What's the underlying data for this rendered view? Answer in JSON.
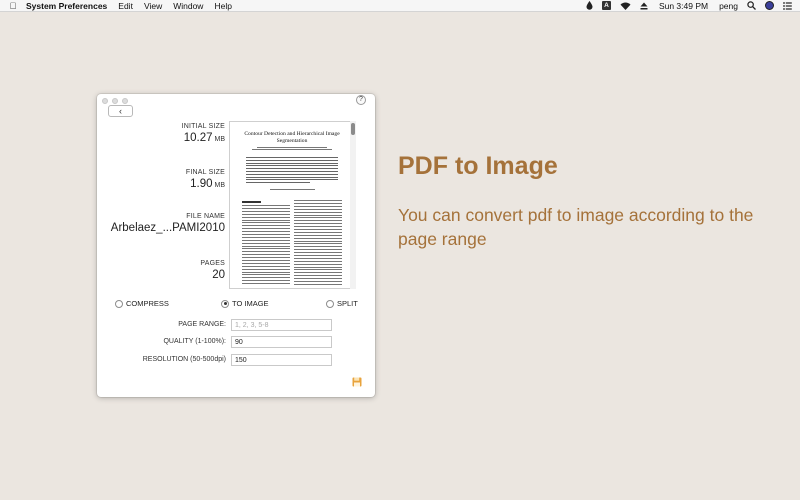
{
  "menubar": {
    "app_name": "System Preferences",
    "menus": [
      "Edit",
      "View",
      "Window",
      "Help"
    ],
    "clock": "Sun 3:49 PM",
    "user": "peng",
    "input_source": "A"
  },
  "panel": {
    "initial_size": {
      "label": "INITIAL SIZE",
      "value": "10.27",
      "unit": "MB"
    },
    "final_size": {
      "label": "FINAL SIZE",
      "value": "1.90",
      "unit": "MB"
    },
    "file_name": {
      "label": "FILE NAME",
      "value": "Arbelaez_...PAMI2010"
    },
    "pages": {
      "label": "PAGES",
      "value": "20"
    },
    "preview": {
      "title": "Contour Detection and Hierarchical Image Segmentation"
    },
    "modes": [
      {
        "label": "COMPRESS",
        "selected": false
      },
      {
        "label": "TO IMAGE",
        "selected": true
      },
      {
        "label": "SPLIT",
        "selected": false
      }
    ],
    "form": {
      "page_range": {
        "label": "PAGE RANGE:",
        "value": "",
        "placeholder": "1, 2, 3, 5-8"
      },
      "quality": {
        "label": "QUALITY (1-100%):",
        "value": "90"
      },
      "resolution": {
        "label": "RESOLUTION (50-500dpi)",
        "value": "150"
      }
    }
  },
  "promo": {
    "title": "PDF to Image",
    "description": "You can convert pdf to image according to the page range"
  },
  "colors": {
    "background": "#ebe6e0",
    "accent": "#a5723a",
    "save_icon": "#e8a33c"
  },
  "icons": {
    "menubar_left": "apple-icon",
    "menubar_right": [
      "drop-icon",
      "input-source-icon",
      "wifi-icon",
      "eject-icon",
      "search-icon",
      "globe-icon",
      "list-icon"
    ],
    "window": [
      "back-chevron-icon",
      "help-icon",
      "save-icon"
    ]
  }
}
